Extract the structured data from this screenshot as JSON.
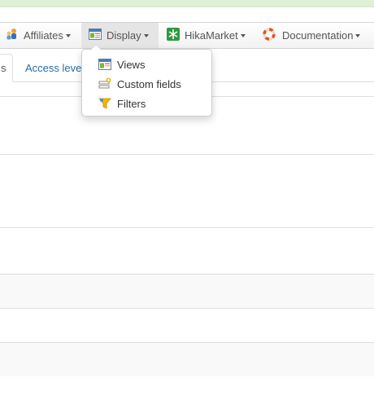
{
  "navbar": {
    "items": [
      {
        "label": "Affiliates",
        "icon": "affiliates-icon"
      },
      {
        "label": "Display",
        "icon": "display-icon",
        "active": true
      },
      {
        "label": "HikaMarket",
        "icon": "hikamarket-icon"
      },
      {
        "label": "Documentation",
        "icon": "lifebuoy-icon"
      }
    ]
  },
  "dropdown": {
    "items": [
      {
        "label": "Views",
        "icon": "views-icon"
      },
      {
        "label": "Custom fields",
        "icon": "custom-fields-icon"
      },
      {
        "label": "Filters",
        "icon": "filters-icon"
      }
    ]
  },
  "tabs": {
    "active_label": "s",
    "access_label": "Access leve"
  },
  "colors": {
    "banner": "#dff0d8",
    "link": "#2a6ca3",
    "hikamarket_green": "#2e9a3e",
    "lifebuoy_red": "#d9541e"
  }
}
